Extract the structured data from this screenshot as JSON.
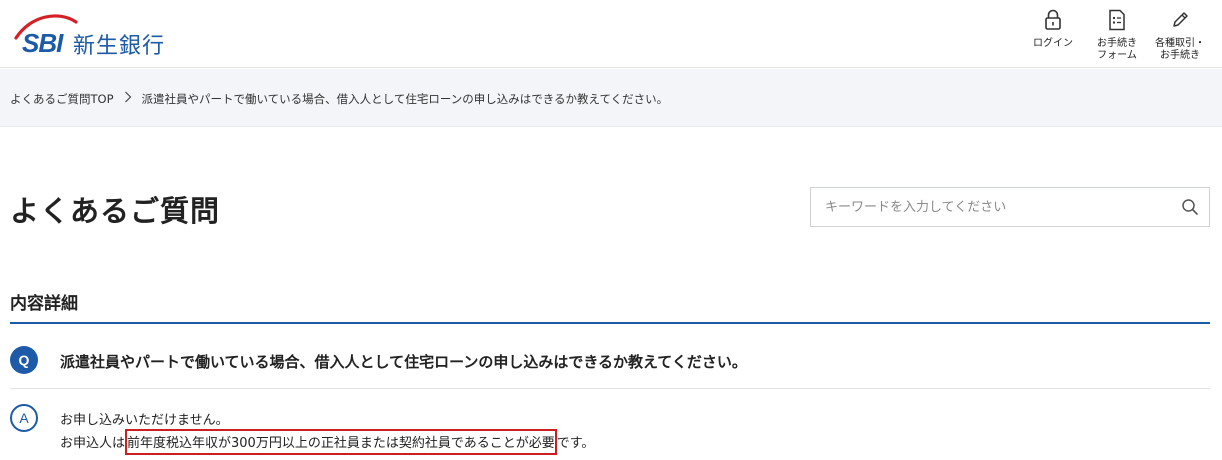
{
  "header": {
    "logo_text": "SBI",
    "bank_name": "新生銀行",
    "nav": [
      {
        "label": "ログイン",
        "icon": "lock-icon"
      },
      {
        "label": "お手続き\nフォーム",
        "icon": "document-icon"
      },
      {
        "label": "各種取引・\nお手続き",
        "icon": "pencil-icon"
      }
    ]
  },
  "breadcrumb": {
    "home": "よくあるご質問TOP",
    "current": "派遣社員やパートで働いている場合、借入人として住宅ローンの申し込みはできるか教えてください。"
  },
  "page": {
    "title": "よくあるご質問"
  },
  "search": {
    "placeholder": "キーワードを入力してください",
    "value": ""
  },
  "detail": {
    "section_title": "内容詳細",
    "question_badge": "Q",
    "question": "派遣社員やパートで働いている場合、借入人として住宅ローンの申し込みはできるか教えてください。",
    "answer_badge": "A",
    "answer_line1": "お申し込みいただけません。",
    "answer_line2_prefix": "お申込人は",
    "answer_line2_highlight": "前年度税込年収が300万円以上の正社員または契約社員であることが必要",
    "answer_line2_suffix": "です。"
  },
  "colors": {
    "brand_blue": "#1d5aa8",
    "logo_swoosh_red": "#d42127",
    "highlight_red": "#cc1f1f"
  }
}
